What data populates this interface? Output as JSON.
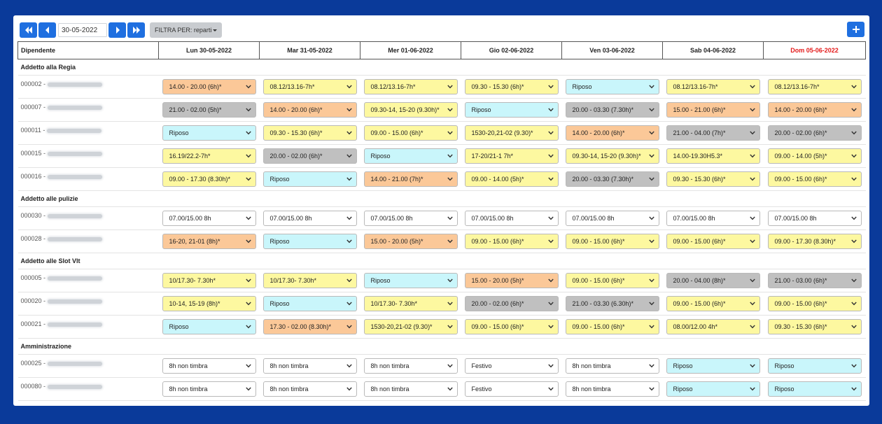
{
  "toolbar": {
    "date_value": "30-05-2022",
    "filter_label": "FILTRA PER: reparti"
  },
  "table": {
    "emp_header": "Dipendente",
    "days": [
      "Lun 30-05-2022",
      "Mar 31-05-2022",
      "Mer 01-06-2022",
      "Gio 02-06-2022",
      "Ven 03-06-2022",
      "Sab 04-06-2022",
      "Dom 05-06-2022"
    ]
  },
  "colors": {
    "yellow": "#fdf8a0",
    "orange": "#fbc898",
    "cyan": "#c9f6fb",
    "gray": "#c0c0c0",
    "white": "#ffffff",
    "accent": "#1f6fe0",
    "sunday": "#e41b1b"
  },
  "groups": [
    {
      "name": "Addetto alla Regia",
      "employees": [
        {
          "code": "000002 -",
          "shifts": [
            {
              "label": "14.00 - 20.00 (6h)*",
              "color": "orange"
            },
            {
              "label": "08.12/13.16-7h*",
              "color": "yellow"
            },
            {
              "label": "08.12/13.16-7h*",
              "color": "yellow"
            },
            {
              "label": "09.30 - 15.30 (6h)*",
              "color": "yellow"
            },
            {
              "label": "Riposo",
              "color": "cyan"
            },
            {
              "label": "08.12/13.16-7h*",
              "color": "yellow"
            },
            {
              "label": "08.12/13.16-7h*",
              "color": "yellow"
            }
          ]
        },
        {
          "code": "000007 -",
          "shifts": [
            {
              "label": "21.00 - 02.00 (5h)*",
              "color": "gray"
            },
            {
              "label": "14.00 - 20.00 (6h)*",
              "color": "orange"
            },
            {
              "label": "09.30-14, 15-20 (9.30h)*",
              "color": "yellow"
            },
            {
              "label": "Riposo",
              "color": "cyan"
            },
            {
              "label": "20.00 - 03.30 (7.30h)*",
              "color": "gray"
            },
            {
              "label": "15.00 - 21.00 (6h)*",
              "color": "orange"
            },
            {
              "label": "14.00 - 20.00 (6h)*",
              "color": "orange"
            }
          ]
        },
        {
          "code": "000011 -",
          "shifts": [
            {
              "label": "Riposo",
              "color": "cyan"
            },
            {
              "label": "09.30 - 15.30 (6h)*",
              "color": "yellow"
            },
            {
              "label": "09.00 - 15.00 (6h)*",
              "color": "yellow"
            },
            {
              "label": "1530-20,21-02 (9.30)*",
              "color": "yellow"
            },
            {
              "label": "14.00 - 20.00 (6h)*",
              "color": "orange"
            },
            {
              "label": "21.00 - 04.00 (7h)*",
              "color": "gray"
            },
            {
              "label": "20.00 - 02.00 (6h)*",
              "color": "gray"
            }
          ]
        },
        {
          "code": "000015 -",
          "shifts": [
            {
              "label": "16.19/22.2-7h*",
              "color": "yellow"
            },
            {
              "label": "20.00 - 02.00 (6h)*",
              "color": "gray"
            },
            {
              "label": "Riposo",
              "color": "cyan"
            },
            {
              "label": "17-20/21-1 7h*",
              "color": "yellow"
            },
            {
              "label": "09.30-14, 15-20 (9.30h)*",
              "color": "yellow"
            },
            {
              "label": "14.00-19.30H5.3*",
              "color": "yellow"
            },
            {
              "label": "09.00 - 14.00 (5h)*",
              "color": "yellow"
            }
          ]
        },
        {
          "code": "000016 -",
          "shifts": [
            {
              "label": "09.00 - 17.30 (8.30h)*",
              "color": "yellow"
            },
            {
              "label": "Riposo",
              "color": "cyan"
            },
            {
              "label": "14.00 - 21.00 (7h)*",
              "color": "orange"
            },
            {
              "label": "09.00 - 14.00 (5h)*",
              "color": "yellow"
            },
            {
              "label": "20.00 - 03.30 (7.30h)*",
              "color": "gray"
            },
            {
              "label": "09.30 - 15.30 (6h)*",
              "color": "yellow"
            },
            {
              "label": "09.00 - 15.00 (6h)*",
              "color": "yellow"
            }
          ]
        }
      ]
    },
    {
      "name": "Addetto alle pulizie",
      "employees": [
        {
          "code": "000030 -",
          "shifts": [
            {
              "label": "07.00/15.00 8h",
              "color": "white"
            },
            {
              "label": "07.00/15.00 8h",
              "color": "white"
            },
            {
              "label": "07.00/15.00 8h",
              "color": "white"
            },
            {
              "label": "07.00/15.00 8h",
              "color": "white"
            },
            {
              "label": "07.00/15.00 8h",
              "color": "white"
            },
            {
              "label": "07.00/15.00 8h",
              "color": "white"
            },
            {
              "label": "07.00/15.00 8h",
              "color": "white"
            }
          ]
        },
        {
          "code": "000028 -",
          "shifts": [
            {
              "label": "16-20, 21-01 (8h)*",
              "color": "orange"
            },
            {
              "label": "Riposo",
              "color": "cyan"
            },
            {
              "label": "15.00 - 20.00 (5h)*",
              "color": "orange"
            },
            {
              "label": "09.00 - 15.00 (6h)*",
              "color": "yellow"
            },
            {
              "label": "09.00 - 15.00 (6h)*",
              "color": "yellow"
            },
            {
              "label": "09.00 - 15.00 (6h)*",
              "color": "yellow"
            },
            {
              "label": "09.00 - 17.30 (8.30h)*",
              "color": "yellow"
            }
          ]
        }
      ]
    },
    {
      "name": "Addetto alle Slot Vlt",
      "employees": [
        {
          "code": "000005 -",
          "shifts": [
            {
              "label": "10/17.30- 7.30h*",
              "color": "yellow"
            },
            {
              "label": "10/17.30- 7.30h*",
              "color": "yellow"
            },
            {
              "label": "Riposo",
              "color": "cyan"
            },
            {
              "label": "15.00 - 20.00 (5h)*",
              "color": "orange"
            },
            {
              "label": "09.00 - 15.00 (6h)*",
              "color": "yellow"
            },
            {
              "label": "20.00 - 04.00 (8h)*",
              "color": "gray"
            },
            {
              "label": "21.00 - 03.00 (6h)*",
              "color": "gray"
            }
          ]
        },
        {
          "code": "000020 -",
          "shifts": [
            {
              "label": "10-14, 15-19 (8h)*",
              "color": "yellow"
            },
            {
              "label": "Riposo",
              "color": "cyan"
            },
            {
              "label": "10/17.30- 7.30h*",
              "color": "yellow"
            },
            {
              "label": "20.00 - 02.00 (6h)*",
              "color": "gray"
            },
            {
              "label": "21.00 - 03.30 (6.30h)*",
              "color": "gray"
            },
            {
              "label": "09.00 - 15.00 (6h)*",
              "color": "yellow"
            },
            {
              "label": "09.00 - 15.00 (6h)*",
              "color": "yellow"
            }
          ]
        },
        {
          "code": "000021 -",
          "shifts": [
            {
              "label": "Riposo",
              "color": "cyan"
            },
            {
              "label": "17.30 - 02.00 (8.30h)*",
              "color": "orange"
            },
            {
              "label": "1530-20,21-02 (9.30)*",
              "color": "yellow"
            },
            {
              "label": "09.00 - 15.00 (6h)*",
              "color": "yellow"
            },
            {
              "label": "09.00 - 15.00 (6h)*",
              "color": "yellow"
            },
            {
              "label": "08.00/12.00 4h*",
              "color": "yellow"
            },
            {
              "label": "09.30 - 15.30 (6h)*",
              "color": "yellow"
            }
          ]
        }
      ]
    },
    {
      "name": "Amministrazione",
      "employees": [
        {
          "code": "000025 -",
          "shifts": [
            {
              "label": "8h non timbra",
              "color": "white"
            },
            {
              "label": "8h non timbra",
              "color": "white"
            },
            {
              "label": "8h non timbra",
              "color": "white"
            },
            {
              "label": "Festivo",
              "color": "white"
            },
            {
              "label": "8h non timbra",
              "color": "white"
            },
            {
              "label": "Riposo",
              "color": "cyan"
            },
            {
              "label": "Riposo",
              "color": "cyan"
            }
          ]
        },
        {
          "code": "000080 -",
          "shifts": [
            {
              "label": "8h non timbra",
              "color": "white"
            },
            {
              "label": "8h non timbra",
              "color": "white"
            },
            {
              "label": "8h non timbra",
              "color": "white"
            },
            {
              "label": "Festivo",
              "color": "white"
            },
            {
              "label": "8h non timbra",
              "color": "white"
            },
            {
              "label": "Riposo",
              "color": "cyan"
            },
            {
              "label": "Riposo",
              "color": "cyan"
            }
          ]
        }
      ]
    }
  ]
}
